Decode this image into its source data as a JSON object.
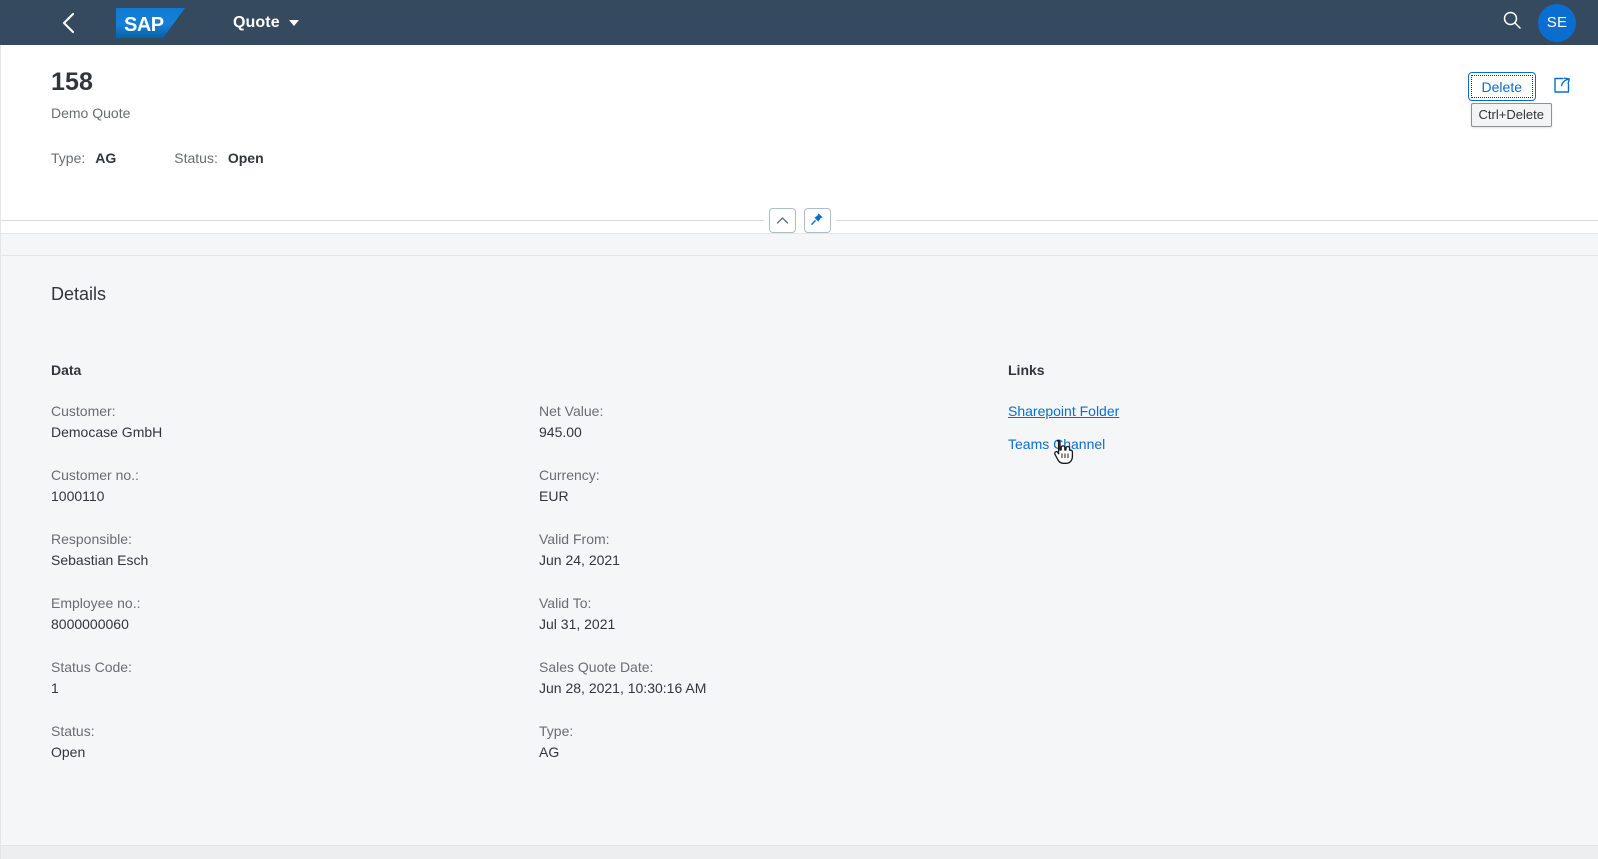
{
  "shell": {
    "back_icon": "chevron-left-icon",
    "logo_text": "SAP",
    "app_title": "Quote",
    "search_icon": "search-icon",
    "avatar_initials": "SE",
    "background_color": "#354a5f",
    "accent_color": "#0a6ed1"
  },
  "object_header": {
    "title": "158",
    "subtitle": "Demo Quote",
    "status_line": [
      {
        "label": "Type:",
        "value": "AG"
      },
      {
        "label": "Status:",
        "value": "Open"
      }
    ],
    "actions": {
      "delete_label": "Delete",
      "delete_tooltip": "Ctrl+Delete",
      "share_icon": "share-export-icon"
    },
    "collapse_icon": "chevron-up-icon",
    "pin_icon": "pin-icon"
  },
  "content": {
    "section_title": "Details",
    "data_group": {
      "title": "Data",
      "fields": [
        {
          "label": "Customer:",
          "value": "Democase GmbH"
        },
        {
          "label": "Customer no.:",
          "value": "1000110"
        },
        {
          "label": "Responsible:",
          "value": "Sebastian Esch"
        },
        {
          "label": "Employee no.:",
          "value": "8000000060"
        },
        {
          "label": "Status Code:",
          "value": "1"
        },
        {
          "label": "Status:",
          "value": "Open"
        }
      ]
    },
    "second_group": {
      "fields": [
        {
          "label": "Net Value:",
          "value": "945.00"
        },
        {
          "label": "Currency:",
          "value": "EUR"
        },
        {
          "label": "Valid From:",
          "value": "Jun 24, 2021"
        },
        {
          "label": "Valid To:",
          "value": "Jul 31, 2021"
        },
        {
          "label": "Sales Quote Date:",
          "value": "Jun 28, 2021, 10:30:16 AM"
        },
        {
          "label": "Type:",
          "value": "AG"
        }
      ]
    },
    "links_group": {
      "title": "Links",
      "items": [
        {
          "label": "Sharepoint Folder",
          "hovered": true
        },
        {
          "label": "Teams Channel",
          "hovered": false
        }
      ]
    }
  }
}
